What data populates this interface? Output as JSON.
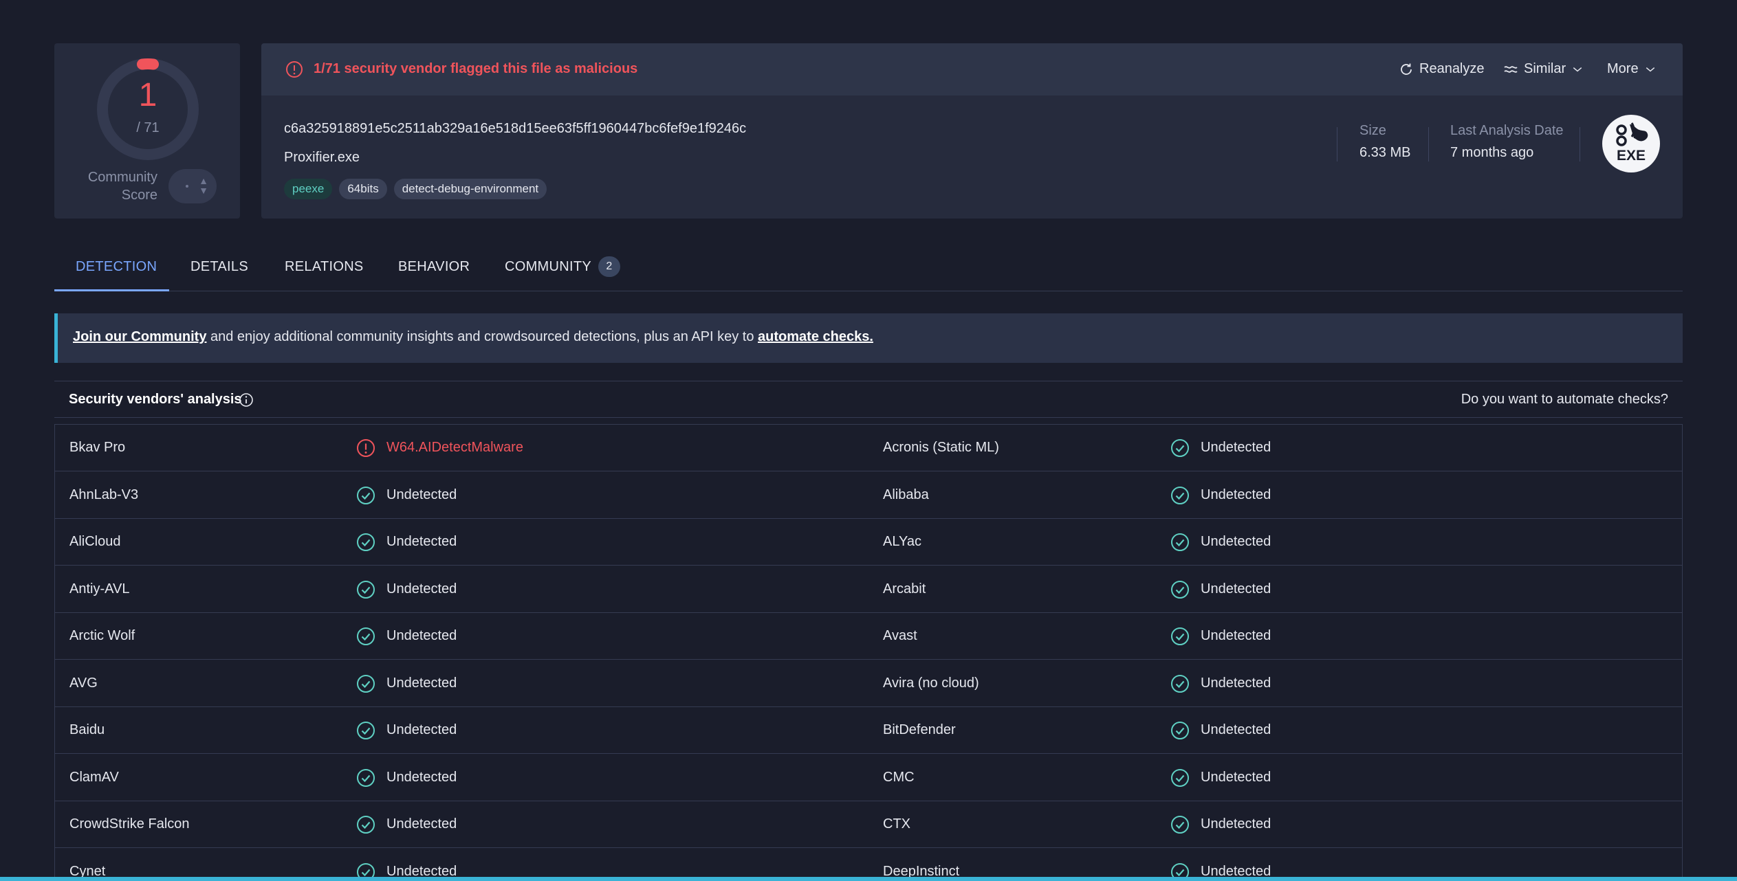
{
  "score": {
    "detections": "1",
    "total": "/ 71",
    "community_label": "Community Score",
    "colors": {
      "malicious": "#f0545b",
      "track": "#343a50"
    }
  },
  "alert": {
    "text": "1/71 security vendor flagged this file as malicious",
    "icon": "alert-circle-icon"
  },
  "actions": {
    "reanalyze": "Reanalyze",
    "similar": "Similar",
    "more": "More"
  },
  "file": {
    "hash": "c6a325918891e5c2511ab329a16e518d15ee63f5ff1960447bc6fef9e1f9246c",
    "name": "Proxifier.exe",
    "tags": [
      "peexe",
      "64bits",
      "detect-debug-environment"
    ],
    "size_label": "Size",
    "size_value": "6.33 MB",
    "date_label": "Last Analysis Date",
    "date_value": "7 months ago",
    "type_badge": "EXE"
  },
  "tabs": {
    "detection": "DETECTION",
    "details": "DETAILS",
    "relations": "RELATIONS",
    "behavior": "BEHAVIOR",
    "community": "COMMUNITY",
    "community_count": "2"
  },
  "banner": {
    "link1": "Join our Community",
    "middle": " and enjoy additional community insights and crowdsourced detections, plus an API key to ",
    "link2": "automate checks."
  },
  "section": {
    "title": "Security vendors' analysis",
    "automate_question": "Do you want to automate checks?"
  },
  "vendors": [
    {
      "left": {
        "name": "Bkav Pro",
        "result": "W64.AIDetectMalware",
        "malicious": true
      },
      "right": {
        "name": "Acronis (Static ML)",
        "result": "Undetected",
        "malicious": false
      }
    },
    {
      "left": {
        "name": "AhnLab-V3",
        "result": "Undetected",
        "malicious": false
      },
      "right": {
        "name": "Alibaba",
        "result": "Undetected",
        "malicious": false
      }
    },
    {
      "left": {
        "name": "AliCloud",
        "result": "Undetected",
        "malicious": false
      },
      "right": {
        "name": "ALYac",
        "result": "Undetected",
        "malicious": false
      }
    },
    {
      "left": {
        "name": "Antiy-AVL",
        "result": "Undetected",
        "malicious": false
      },
      "right": {
        "name": "Arcabit",
        "result": "Undetected",
        "malicious": false
      }
    },
    {
      "left": {
        "name": "Arctic Wolf",
        "result": "Undetected",
        "malicious": false
      },
      "right": {
        "name": "Avast",
        "result": "Undetected",
        "malicious": false
      }
    },
    {
      "left": {
        "name": "AVG",
        "result": "Undetected",
        "malicious": false
      },
      "right": {
        "name": "Avira (no cloud)",
        "result": "Undetected",
        "malicious": false
      }
    },
    {
      "left": {
        "name": "Baidu",
        "result": "Undetected",
        "malicious": false
      },
      "right": {
        "name": "BitDefender",
        "result": "Undetected",
        "malicious": false
      }
    },
    {
      "left": {
        "name": "ClamAV",
        "result": "Undetected",
        "malicious": false
      },
      "right": {
        "name": "CMC",
        "result": "Undetected",
        "malicious": false
      }
    },
    {
      "left": {
        "name": "CrowdStrike Falcon",
        "result": "Undetected",
        "malicious": false
      },
      "right": {
        "name": "CTX",
        "result": "Undetected",
        "malicious": false
      }
    },
    {
      "left": {
        "name": "Cynet",
        "result": "Undetected",
        "malicious": false
      },
      "right": {
        "name": "DeepInstinct",
        "result": "Undetected",
        "malicious": false
      }
    }
  ]
}
